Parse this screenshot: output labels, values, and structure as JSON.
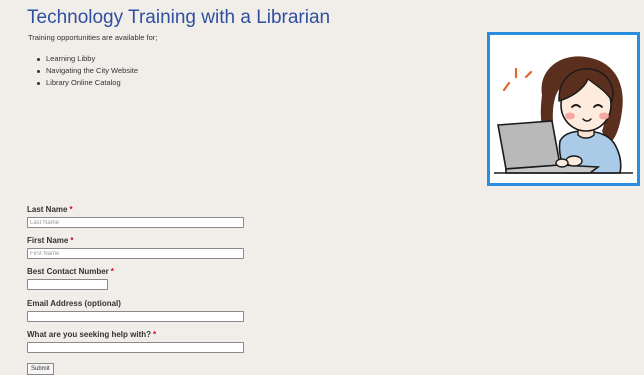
{
  "page": {
    "title": "Technology Training with a Librarian",
    "intro": "Training opportunities are available for;",
    "topics": [
      "Learning Libby",
      "Navigating the City Website",
      "Library Online Catalog"
    ]
  },
  "illustration": {
    "subject": "woman-using-laptop",
    "frame_color": "#2a8ddf"
  },
  "form": {
    "required_marker": "*",
    "fields": [
      {
        "label": "Last Name",
        "placeholder": "Last Name",
        "value": "",
        "required": true
      },
      {
        "label": "First Name",
        "placeholder": "First Name",
        "value": "",
        "required": true
      },
      {
        "label": "Best Contact Number",
        "placeholder": "",
        "value": "",
        "required": true
      },
      {
        "label": "Email Address (optional)",
        "placeholder": "",
        "value": "",
        "required": false
      },
      {
        "label": "What are you seeking help with?",
        "placeholder": "",
        "value": "",
        "required": true
      }
    ],
    "submit_label": "Submit"
  },
  "colors": {
    "background": "#f1eeea",
    "title": "#2f4fa0",
    "required": "#d0021b"
  }
}
